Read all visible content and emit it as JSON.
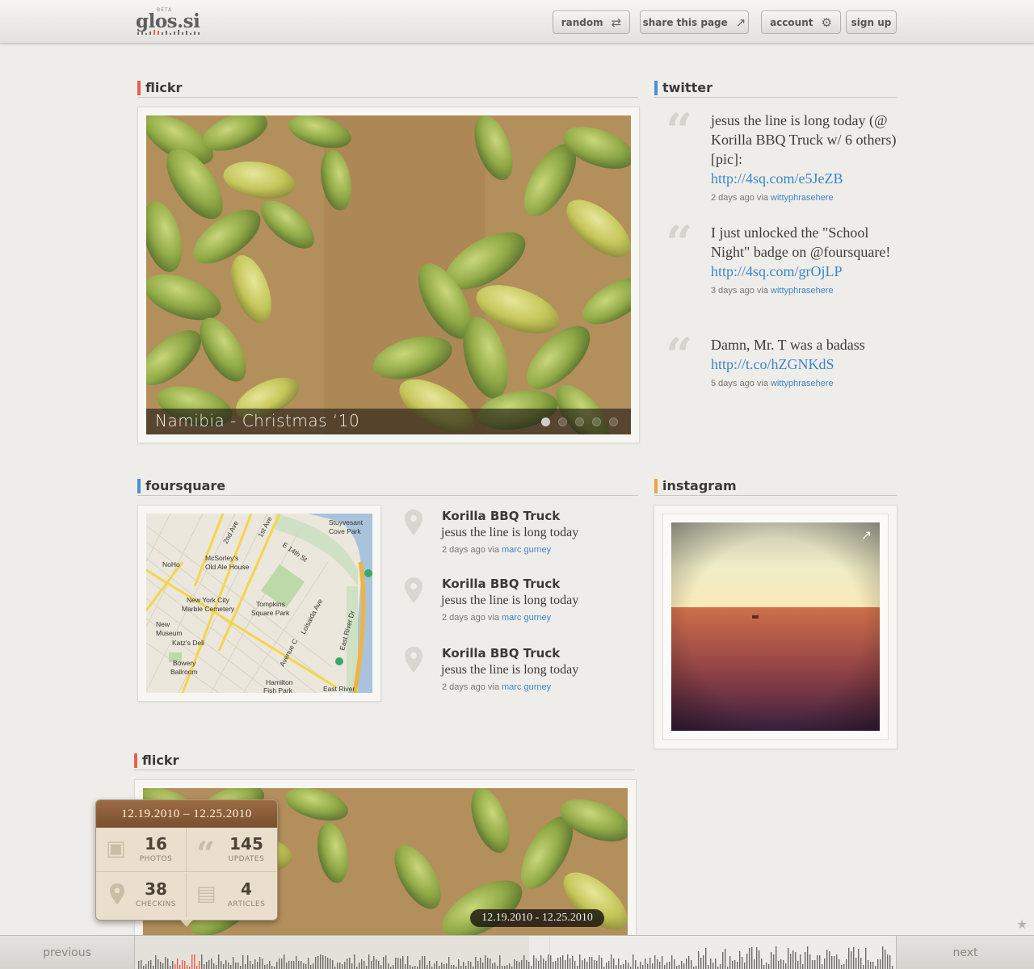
{
  "header": {
    "logo_text": "glos.si",
    "logo_badge": "BETA",
    "buttons": {
      "random": "random",
      "share": "share this page",
      "account": "account",
      "signup": "sign up"
    }
  },
  "sections": {
    "flickr": {
      "title": "flickr",
      "caption": "Namibia - Christmas ‘10",
      "slide_count": 5,
      "active_slide": 1
    },
    "twitter": {
      "title": "twitter",
      "tweets": [
        {
          "text": "jesus the line is long today (@ Korilla BBQ Truck w/ 6 others) [pic]:",
          "link": "http://4sq.com/e5JeZB",
          "time": "2 days ago",
          "via_label": "via",
          "via": "wittyphrasehere"
        },
        {
          "text": "I just unlocked the \"School Night\" badge on @foursquare!",
          "link": "http://4sq.com/grOjLP",
          "time": "3 days ago",
          "via_label": "via",
          "via": "wittyphrasehere"
        },
        {
          "text": "Damn, Mr. T was a badass",
          "link": "http://t.co/hZGNKdS",
          "time": "5 days ago",
          "via_label": "via",
          "via": "wittyphrasehere"
        }
      ]
    },
    "foursquare": {
      "title": "foursquare",
      "map_labels": [
        "Stuyvesant Cove Park",
        "NoHo",
        "McSorley's Old Ale House",
        "2nd Ave",
        "1st Ave",
        "E 14th St",
        "New York City Marble Cemetery",
        "Tompkins Square Park",
        "Loisaida Ave",
        "Avenue C",
        "East River Dr",
        "New Museum",
        "Katz's Deli",
        "Bowery Ballroom",
        "Hamilton Fish Park",
        "East River"
      ],
      "checkins": [
        {
          "venue": "Korilla BBQ Truck",
          "text": "jesus the line is long today",
          "time": "2 days ago",
          "via_label": "via",
          "via": "marc gurney"
        },
        {
          "venue": "Korilla BBQ Truck",
          "text": "jesus the line is long today",
          "time": "2 days ago",
          "via_label": "via",
          "via": "marc gurney"
        },
        {
          "venue": "Korilla BBQ Truck",
          "text": "jesus the line is long today",
          "time": "2 days ago",
          "via_label": "via",
          "via": "marc gurney"
        }
      ]
    },
    "instagram": {
      "title": "instagram"
    },
    "flickr2": {
      "title": "flickr"
    }
  },
  "stats": {
    "date_range": "12.19.2010 – 12.25.2010",
    "photos": {
      "value": "16",
      "label": "PHOTOS"
    },
    "updates": {
      "value": "145",
      "label": "UPDATES"
    },
    "checkins": {
      "value": "38",
      "label": "CHECKINS"
    },
    "articles": {
      "value": "4",
      "label": "ARTICLES"
    }
  },
  "date_badge": "12.19.2010 - 12.25.2010",
  "timeline": {
    "previous": "previous",
    "next": "next"
  },
  "colors": {
    "flickr_accent": "#e8614a",
    "twitter_accent": "#4a8fd1",
    "foursquare_accent": "#4a8fd1",
    "instagram_accent": "#f0a040",
    "link": "#3d86c6",
    "stats_header": "#8a5a37"
  }
}
